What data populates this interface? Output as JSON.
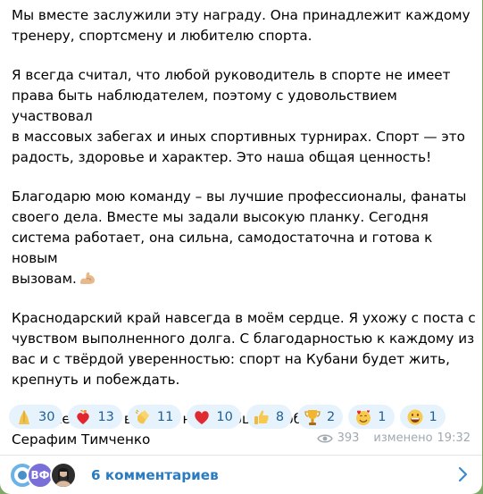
{
  "message": {
    "paragraphs": [
      "Мы вместе заслужили эту награду. Она принадлежит каждому\nтренеру, спортсмену и любителю спорта.",
      "Я всегда считал, что любой руководитель в спорте не имеет\nправа быть наблюдателем, поэтому с удовольствием участвовал\nв массовых забегах и иных спортивных турнирах. Спорт — это\nрадость, здоровье и характер. Это наша общая ценность!",
      "Благодарю мою команду – вы лучшие профессионалы, фанаты\nсвоего дела. Вместе мы задали высокую планку. Сегодня\nсистема работает, она сильна, самодостаточна и готова к новым\nвызовам.",
      "Краснодарский край навсегда в моём сердце. Я ухожу с поста с\nчувством выполненного долга. С благодарностью к каждому из\nвас и с твёрдой уверенностью: спорт на Кубани будет жить,\nкрепнуть и побеждать.",
      "С уважением и верой в наши общие победы,\nСерафим Тимченко"
    ],
    "inline_emoji_icon": "flexed-biceps-icon"
  },
  "reactions": [
    {
      "icon": "folded-hands-icon",
      "count": "30"
    },
    {
      "icon": "heart-on-fire-icon",
      "count": "13"
    },
    {
      "icon": "clapping-hands-icon",
      "count": "11"
    },
    {
      "icon": "red-heart-icon",
      "count": "10"
    },
    {
      "icon": "thumbs-up-icon",
      "count": "8"
    },
    {
      "icon": "trophy-icon",
      "count": "2"
    },
    {
      "icon": "smiling-face-with-hearts-icon",
      "count": "1"
    },
    {
      "icon": "grinning-face-icon",
      "count": "1"
    }
  ],
  "meta": {
    "views": "393",
    "edited_label": "изменено",
    "time": "19:32"
  },
  "comments": {
    "avatar_initials": "ВФ",
    "label": "6 комментариев"
  },
  "colors": {
    "reaction_bg": "#e6f3fc",
    "reaction_count": "#1f5f95",
    "link": "#2a7bbf",
    "meta": "#a0a8b0"
  }
}
